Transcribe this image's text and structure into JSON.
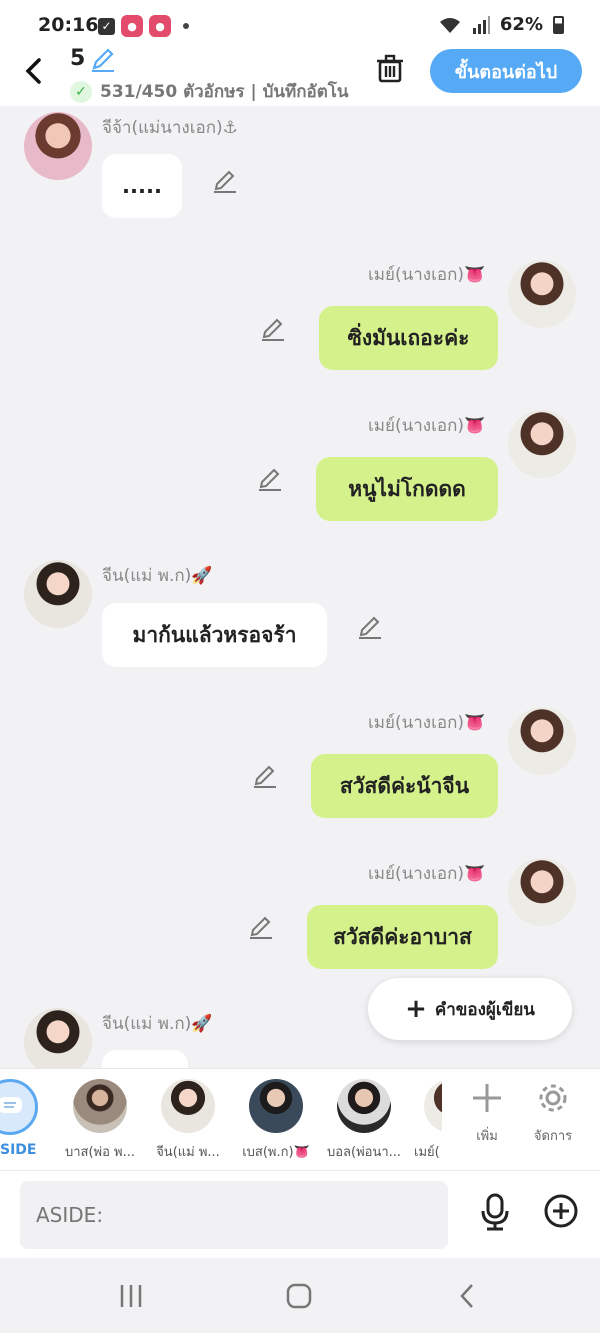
{
  "status": {
    "time": "20:16",
    "battery": "62%",
    "battery_level": 0.62
  },
  "header": {
    "title": "5",
    "counter": "531/450 ตัวอักษร | บันทึกอัตโน",
    "next_button": "ขั้นตอนต่อไป"
  },
  "messages": [
    {
      "name": "จีจ้า(แม่นางเอก)⚓",
      "text": ".....",
      "side": "left"
    },
    {
      "name": "เมย์(นางเอก)👅",
      "text": "ซิ่งมันเถอะค่ะ",
      "side": "right"
    },
    {
      "name": "เมย์(นางเอก)👅",
      "text": "หนูไม่โกดดด",
      "side": "right"
    },
    {
      "name": "จีน(แม่ พ.ก)🚀",
      "text": "มาก้นแล้วหรอจร้า",
      "side": "left"
    },
    {
      "name": "เมย์(นางเอก)👅",
      "text": "สวัสดีค่ะน้าจีน",
      "side": "right"
    },
    {
      "name": "เมย์(นางเอก)👅",
      "text": "สวัสดีค่ะอาบาส",
      "side": "right"
    },
    {
      "name": "จีน(แม่ พ.ก)🚀",
      "text": "",
      "side": "left"
    }
  ],
  "writer_button": "คำของผู้เขียน",
  "characters": {
    "aside_label": "SIDE",
    "items": [
      {
        "label": "บาส(พ่อ พ..."
      },
      {
        "label": "จีน(แม่ พ..."
      },
      {
        "label": "เบส(พ.ก)👅"
      },
      {
        "label": "บอล(พ่อนา..."
      },
      {
        "label": "เมย์("
      }
    ],
    "add_label": "เพิ่ม",
    "manage_label": "จัดการ"
  },
  "input": {
    "placeholder": "ASIDE:"
  },
  "colors": {
    "accent": "#55a9f5",
    "bubble_right": "#d5f18c",
    "bubble_left": "#ffffff"
  }
}
